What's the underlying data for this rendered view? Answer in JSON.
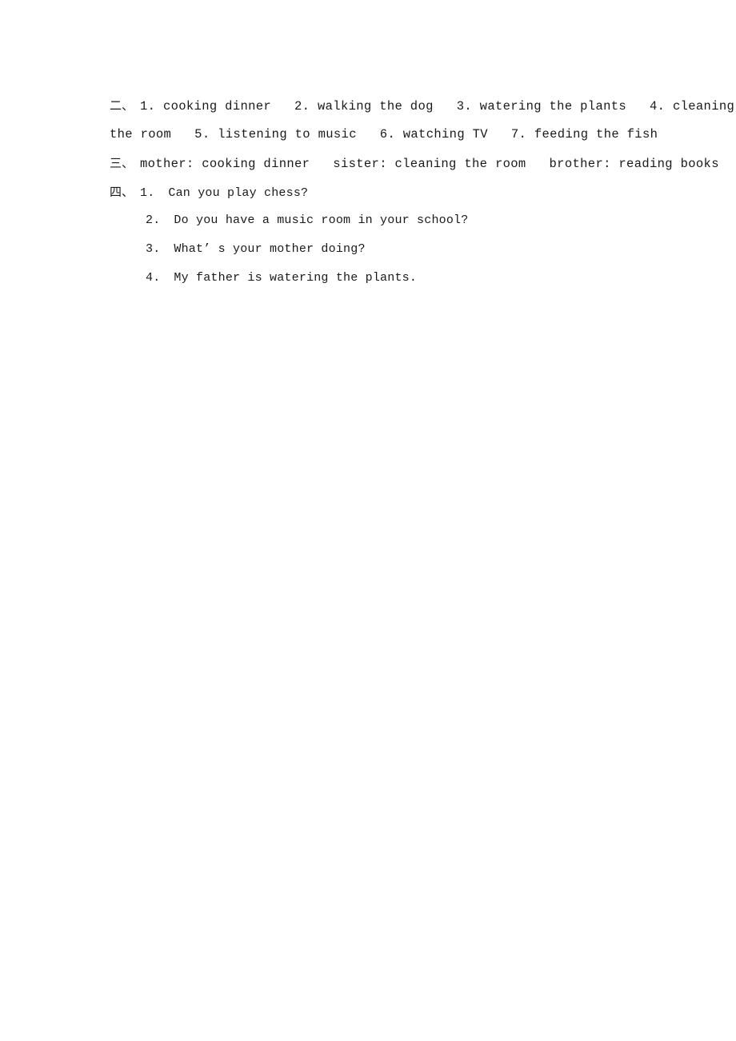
{
  "document": {
    "page_background": "#ffffff",
    "text_color": "#1a1a1a",
    "sections": [
      {
        "marker": "二、",
        "kind": "inline-numbered-list",
        "lines": [
          "1. cooking dinner   2. walking the dog   3. watering the plants   4. cleaning",
          "the room   5. listening to music   6. watching TV   7. feeding the fish"
        ],
        "items": [
          {
            "number": "1.",
            "text": "cooking dinner"
          },
          {
            "number": "2.",
            "text": "walking the dog"
          },
          {
            "number": "3.",
            "text": "watering the plants"
          },
          {
            "number": "4.",
            "text": "cleaning the room"
          },
          {
            "number": "5.",
            "text": "listening to music"
          },
          {
            "number": "6.",
            "text": "watching TV"
          },
          {
            "number": "7.",
            "text": "feeding the fish"
          }
        ]
      },
      {
        "marker": "三、",
        "kind": "inline-pairs",
        "lines": [
          "mother: cooking dinner   sister: cleaning the room   brother: reading books"
        ],
        "pairs": [
          {
            "label": "mother:",
            "value": "cooking dinner"
          },
          {
            "label": "sister:",
            "value": "cleaning the room"
          },
          {
            "label": "brother:",
            "value": "reading books"
          }
        ]
      },
      {
        "marker": "四、",
        "kind": "numbered-sentences",
        "items": [
          {
            "number": "1.",
            "text": "Can you play chess?"
          },
          {
            "number": "2.",
            "text": "Do you have a music room in your school?"
          },
          {
            "number": "3.",
            "text": "What’ s your mother doing?"
          },
          {
            "number": "4.",
            "text": "My father is watering the plants."
          }
        ]
      }
    ]
  }
}
